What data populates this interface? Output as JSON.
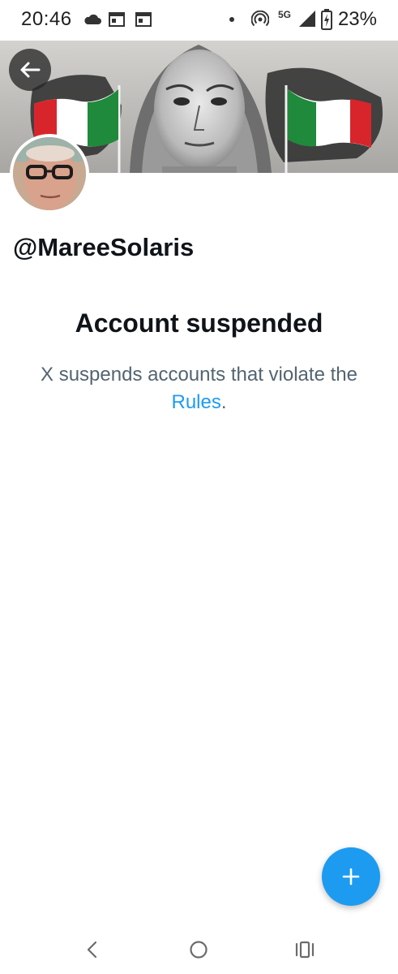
{
  "status_bar": {
    "time": "20:46",
    "network": "5G",
    "battery_percent": "23%",
    "icons": [
      "cloud-icon",
      "calendar-icon",
      "calendar-icon",
      "dot-icon",
      "hotspot-icon",
      "signal-icon",
      "battery-charging-icon"
    ]
  },
  "profile": {
    "username": "@MareeSolaris"
  },
  "suspension": {
    "title": "Account suspended",
    "message_prefix": "X suspends accounts that violate the ",
    "rules_link": "Rules",
    "message_suffix": "."
  },
  "colors": {
    "accent": "#1d9bf0",
    "text_primary": "#0f1419",
    "text_secondary": "#536471"
  },
  "nav": {
    "buttons": [
      "back-nav-icon",
      "home-nav-icon",
      "recents-nav-icon"
    ]
  }
}
